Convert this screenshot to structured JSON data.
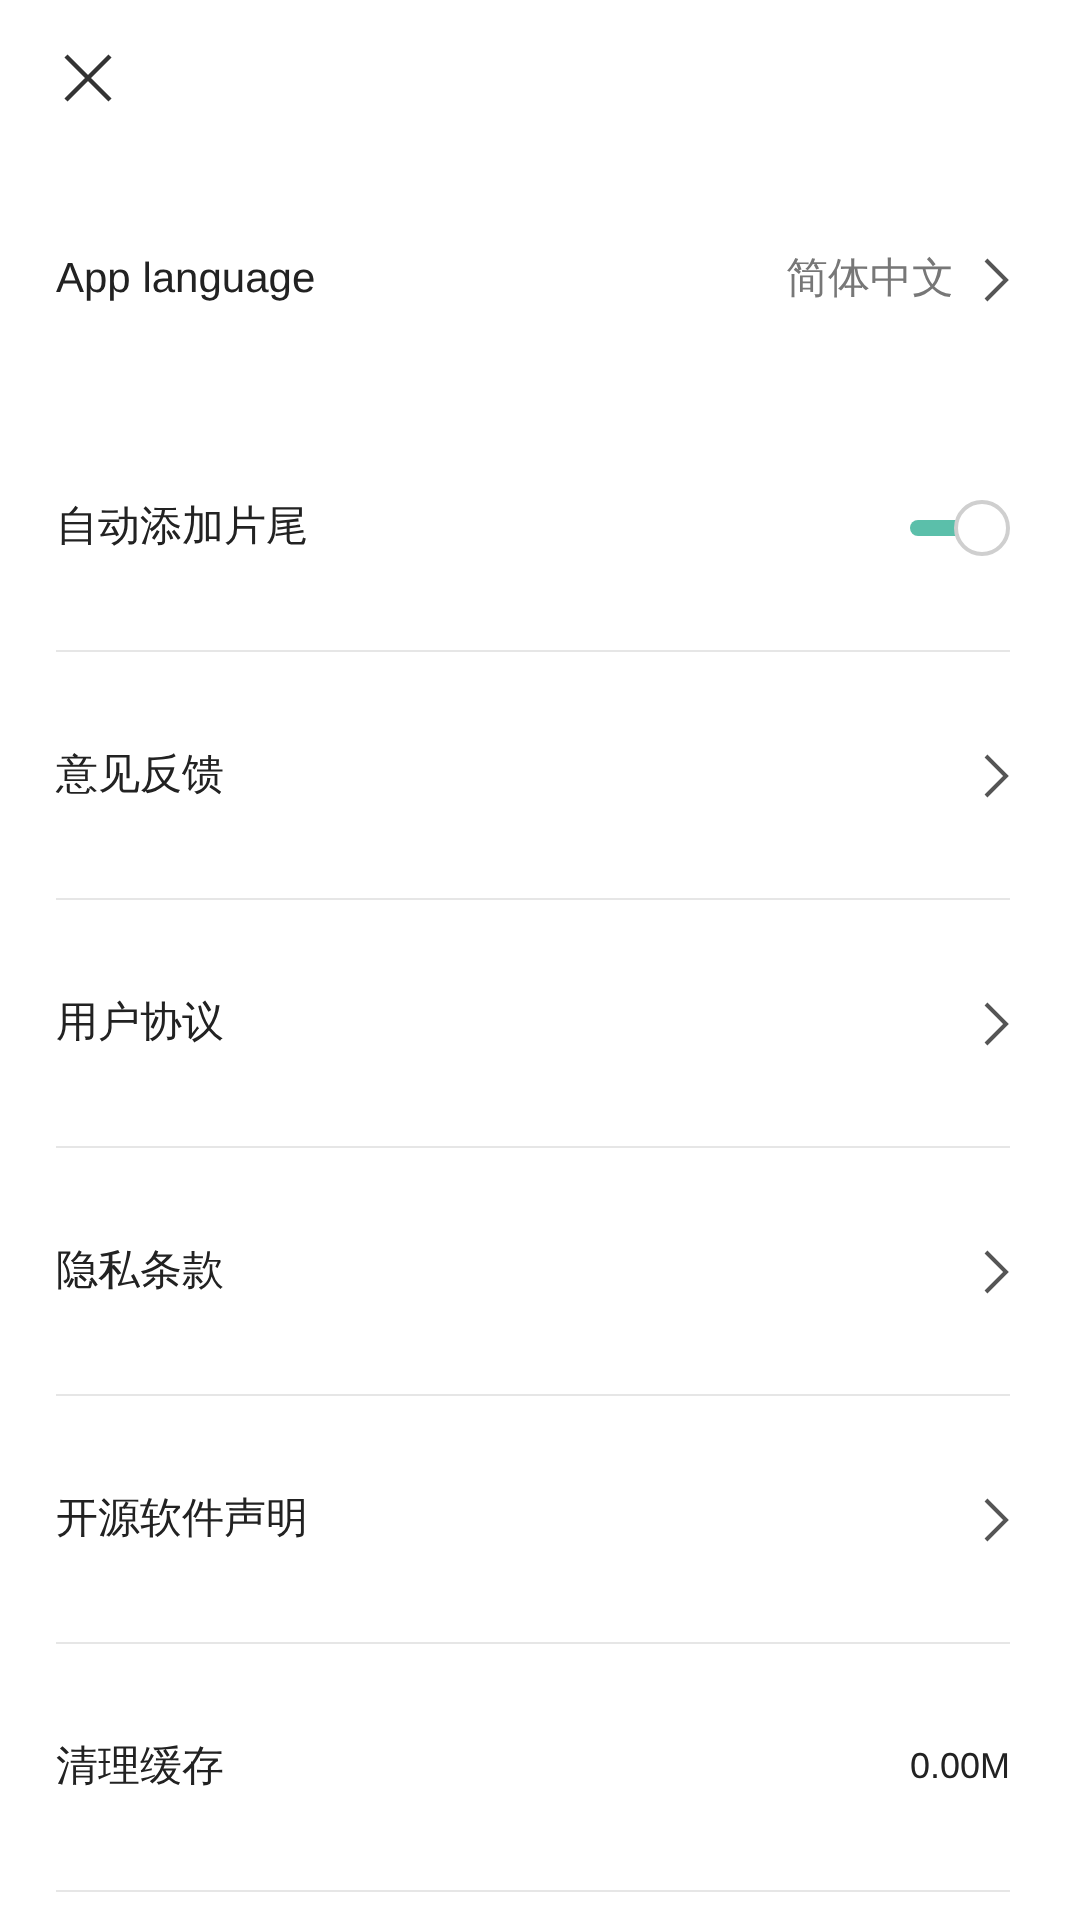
{
  "settings": [
    {
      "kind": "nav",
      "label": "App language",
      "value": "简体中文"
    },
    {
      "kind": "toggle",
      "label": "自动添加片尾",
      "on": true
    },
    {
      "kind": "nav",
      "label": "意见反馈"
    },
    {
      "kind": "nav",
      "label": "用户协议"
    },
    {
      "kind": "nav",
      "label": "隐私条款"
    },
    {
      "kind": "nav",
      "label": "开源软件声明"
    },
    {
      "kind": "value",
      "label": "清理缓存",
      "value": "0.00M"
    }
  ]
}
